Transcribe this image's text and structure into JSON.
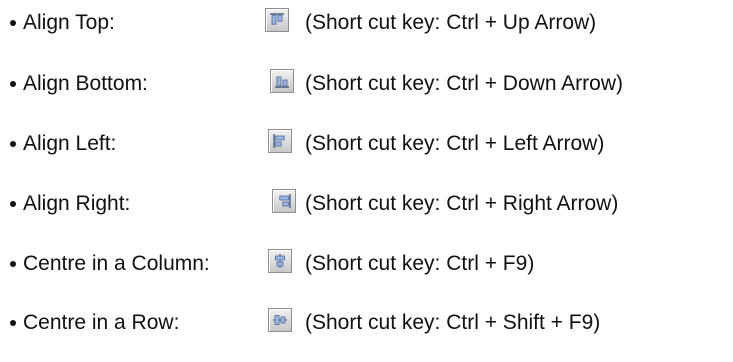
{
  "items": [
    {
      "label": "Align Top:",
      "icon": "align-top-icon",
      "shortcut": "(Short cut key: Ctrl + Up Arrow)"
    },
    {
      "label": "Align Bottom:",
      "icon": "align-bottom-icon",
      "shortcut": "(Short cut key: Ctrl + Down Arrow)"
    },
    {
      "label": "Align Left:",
      "icon": "align-left-icon",
      "shortcut": "(Short cut key: Ctrl + Left Arrow)"
    },
    {
      "label": "Align Right:",
      "icon": "align-right-icon",
      "shortcut": "(Short cut key: Ctrl + Right Arrow)"
    },
    {
      "label": "Centre in a Column:",
      "icon": "centre-column-icon",
      "shortcut": "(Short cut key: Ctrl + F9)"
    },
    {
      "label": "Centre in a Row:",
      "icon": "centre-row-icon",
      "shortcut": "(Short cut key: Ctrl + Shift + F9)"
    }
  ]
}
